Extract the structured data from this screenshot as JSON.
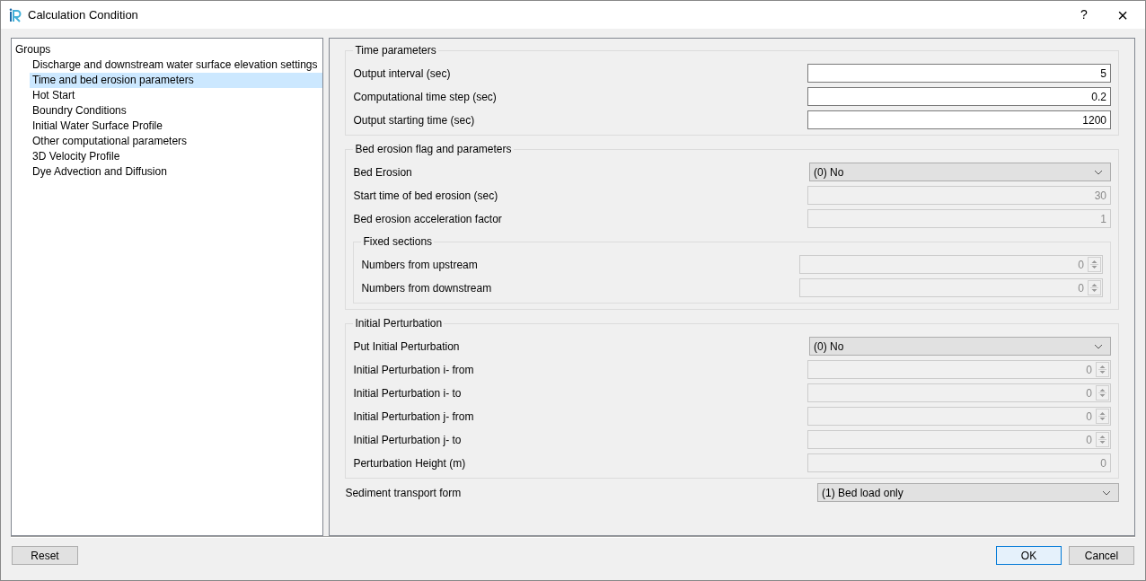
{
  "window": {
    "title": "Calculation Condition",
    "help": "?",
    "close": "×"
  },
  "groups": {
    "header": "Groups",
    "items": [
      {
        "label": "Discharge and downstream water surface elevation settings",
        "selected": false
      },
      {
        "label": "Time and bed erosion parameters",
        "selected": true
      },
      {
        "label": "Hot Start",
        "selected": false
      },
      {
        "label": "Boundry Conditions",
        "selected": false
      },
      {
        "label": "Initial Water Surface Profile",
        "selected": false
      },
      {
        "label": "Other computational parameters",
        "selected": false
      },
      {
        "label": "3D Velocity Profile",
        "selected": false
      },
      {
        "label": "Dye Advection and Diffusion",
        "selected": false
      }
    ]
  },
  "content": [
    {
      "kind": "group",
      "title": "Time parameters",
      "items": [
        {
          "kind": "text",
          "label": "Output interval (sec)",
          "value": "5",
          "disabled": false
        },
        {
          "kind": "text",
          "label": "Computational time step (sec)",
          "value": "0.2",
          "disabled": false
        },
        {
          "kind": "text",
          "label": "Output starting time (sec)",
          "value": "1200",
          "disabled": false
        }
      ]
    },
    {
      "kind": "group",
      "title": "Bed erosion flag and parameters",
      "items": [
        {
          "kind": "combo",
          "label": "Bed Erosion",
          "value": "(0) No",
          "disabled": false
        },
        {
          "kind": "text",
          "label": "Start time of bed erosion (sec)",
          "value": "30",
          "disabled": true
        },
        {
          "kind": "text",
          "label": "Bed erosion acceleration factor",
          "value": "1",
          "disabled": true
        },
        {
          "kind": "group",
          "title": "Fixed sections",
          "items": [
            {
              "kind": "spin",
              "label": "Numbers from upstream",
              "value": "0",
              "disabled": true
            },
            {
              "kind": "spin",
              "label": "Numbers from downstream",
              "value": "0",
              "disabled": true
            }
          ]
        }
      ]
    },
    {
      "kind": "group",
      "title": "Initial Perturbation",
      "items": [
        {
          "kind": "combo",
          "label": "Put Initial Perturbation",
          "value": "(0) No",
          "disabled": false
        },
        {
          "kind": "spin",
          "label": "Initial Perturbation i- from",
          "value": "0",
          "disabled": true
        },
        {
          "kind": "spin",
          "label": "Initial Perturbation i- to",
          "value": "0",
          "disabled": true
        },
        {
          "kind": "spin",
          "label": "Initial Perturbation j- from",
          "value": "0",
          "disabled": true
        },
        {
          "kind": "spin",
          "label": "Initial Perturbation j- to",
          "value": "0",
          "disabled": true
        },
        {
          "kind": "text",
          "label": "Perturbation Height (m)",
          "value": "0",
          "disabled": true
        }
      ]
    },
    {
      "kind": "combo",
      "label": "Sediment transport form",
      "value": "(1) Bed load only",
      "disabled": false
    }
  ],
  "buttons": {
    "reset": "Reset",
    "ok": "OK",
    "cancel": "Cancel"
  }
}
